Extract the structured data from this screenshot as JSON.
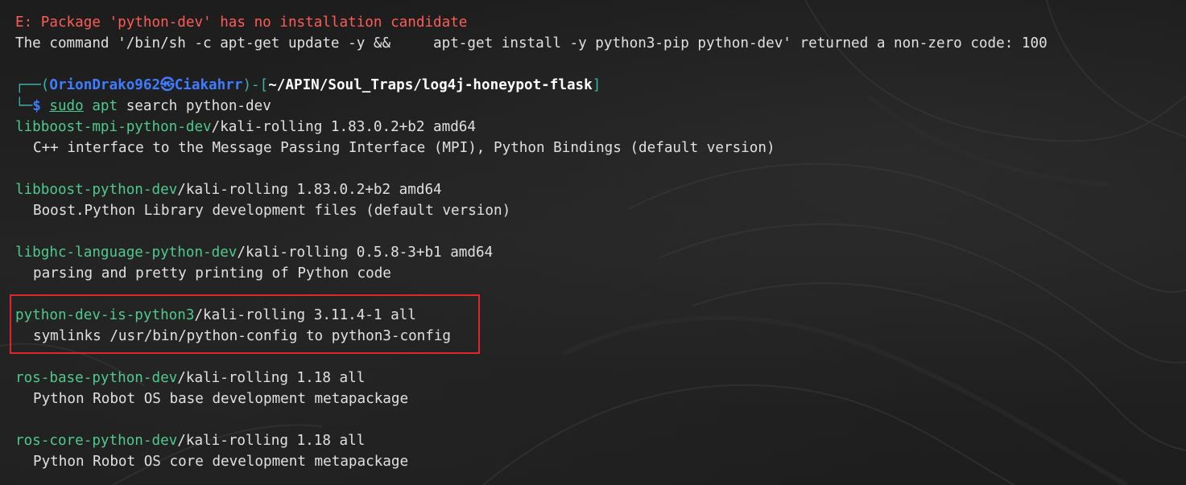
{
  "terminal": {
    "error_line": "E: Package 'python-dev' has no installation candidate",
    "command_error_line": "The command '/bin/sh -c apt-get update -y &&     apt-get install -y python3-pip python-dev' returned a non-zero code: 100",
    "prompt": {
      "frame_top": "┌──(",
      "user": "OrionDrako962",
      "at_symbol": "㉿",
      "host": "Ciakahrr",
      "frame_mid": ")-[",
      "path": "~/APIN/Soul_Traps/log4j-honeypot-flask",
      "frame_end": "]",
      "frame_bottom": "└─",
      "dollar": "$",
      "cmd_sudo": "sudo",
      "cmd_apt": "apt",
      "cmd_rest": "search python-dev"
    },
    "results": [
      {
        "name": "libboost-mpi-python-dev",
        "meta": "/kali-rolling 1.83.0.2+b2 amd64",
        "description": "C++ interface to the Message Passing Interface (MPI), Python Bindings (default version)"
      },
      {
        "name": "libboost-python-dev",
        "meta": "/kali-rolling 1.83.0.2+b2 amd64",
        "description": "Boost.Python Library development files (default version)"
      },
      {
        "name": "libghc-language-python-dev",
        "meta": "/kali-rolling 0.5.8-3+b1 amd64",
        "description": "parsing and pretty printing of Python code"
      },
      {
        "name": "python-dev-is-python3",
        "meta": "/kali-rolling 3.11.4-1 all",
        "description": "symlinks /usr/bin/python-config to python3-config"
      },
      {
        "name": "ros-base-python-dev",
        "meta": "/kali-rolling 1.18 all",
        "description": "Python Robot OS base development metapackage"
      },
      {
        "name": "ros-core-python-dev",
        "meta": "/kali-rolling 1.18 all",
        "description": "Python Robot OS core development metapackage"
      }
    ],
    "colors": {
      "error": "#ff5c57",
      "package_name": "#4fc98d",
      "prompt_user": "#3f7cff",
      "prompt_frame": "#3db0a8",
      "highlight_border": "#e0262b",
      "background": "#1c1c1c"
    }
  }
}
